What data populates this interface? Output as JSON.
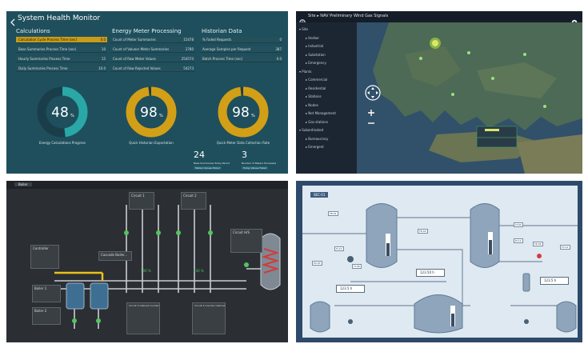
{
  "top_left": {
    "title": "System Health Monitor",
    "calc": {
      "header": "Calculations",
      "rows": [
        {
          "label": "Calculation Cycle Process Time (sec)",
          "value": "0.0"
        },
        {
          "label": "Base Summaries Process Time (sec)",
          "value": "10"
        },
        {
          "label": "Hourly Summaries Process Time",
          "value": "15"
        },
        {
          "label": "Daily Summaries Process Time",
          "value": "10.0"
        }
      ]
    },
    "energy": {
      "header": "Energy Meter Processing",
      "rows": [
        {
          "label": "Count of Meter Summaries",
          "value": "15478"
        },
        {
          "label": "Count of Valueor Meter Summaries",
          "value": "2780"
        },
        {
          "label": "Count of Raw Meter Values",
          "value": "254574"
        },
        {
          "label": "Count of Raw Rejected Values",
          "value": "54273"
        }
      ]
    },
    "historian": {
      "header": "Historian Data",
      "rows": [
        {
          "label": "% Failed Requests",
          "value": "0"
        },
        {
          "label": "Average Samples per Request",
          "value": "387"
        },
        {
          "label": "Batch Process Time (sec)",
          "value": "0.0"
        }
      ]
    },
    "gauges": [
      {
        "value": "48",
        "unit": "%",
        "fraction": 0.48,
        "label": "Energy Calculations Progress",
        "color": "#2aa7a7"
      },
      {
        "value": "98",
        "unit": "%",
        "fraction": 0.98,
        "label": "Quick Historian Expectation",
        "color": "#d29f17"
      },
      {
        "value": "98",
        "unit": "%",
        "fraction": 0.98,
        "label": "Quick Meter Data Collection Rate",
        "color": "#d29f17"
      }
    ],
    "stats": [
      {
        "value": "24",
        "line1": "Base Summaries Today Period",
        "line2": "Meters Values Failed"
      },
      {
        "value": "3",
        "line1": "Number of Meters Processed",
        "line2": "Today Values Failed"
      }
    ]
  },
  "top_right": {
    "toolbar_label": "Site  ▸  NAV  Preliminary  Wind  Gas Signals",
    "tree": [
      {
        "label": "Site",
        "level": 0
      },
      {
        "label": "Harbor",
        "level": 1
      },
      {
        "label": "Industrial",
        "level": 1
      },
      {
        "label": "Substation",
        "level": 1
      },
      {
        "label": "Emergency",
        "level": 1
      },
      {
        "label": "Plants",
        "level": 0
      },
      {
        "label": "Commercial",
        "level": 1
      },
      {
        "label": "Residential",
        "level": 1
      },
      {
        "label": "Stations",
        "level": 1
      },
      {
        "label": "Nodes",
        "level": 1
      },
      {
        "label": "Net Management",
        "level": 1
      },
      {
        "label": "Gas stations",
        "level": 1
      },
      {
        "label": "Subordinated",
        "level": 0
      },
      {
        "label": "Bureaucracy",
        "level": 1
      },
      {
        "label": "Emergent",
        "level": 1
      }
    ]
  },
  "bottom_left": {
    "tab": "Boiler",
    "labels": {
      "circuit1": "Circuit 1",
      "circuit2": "Circuit 2",
      "circuit3": "Circuit 3",
      "circuit4": "Circuit 4",
      "circuit_hs": "Circuit H/S",
      "cascade": "Cascade Boiler...",
      "boiler1": "Boiler 1",
      "boiler2": "Boiler 2",
      "controller": "Controller",
      "circuit3b": "Circuit 3 Cabinet Counter",
      "circuit4b": "Circuit 4 Counter Cabinet"
    },
    "readouts": [
      "100 %",
      "100 %"
    ]
  },
  "bottom_right": {
    "tag": "SEC-01",
    "boxes": [
      "123.50 h",
      "123.5 h",
      "123.5 h"
    ],
    "small_labels": [
      "TE-01",
      "FI-12",
      "PV-03",
      "TE-02",
      "LT-04",
      "PI-11",
      "TE-05",
      "FV-12",
      "TI-06"
    ]
  }
}
